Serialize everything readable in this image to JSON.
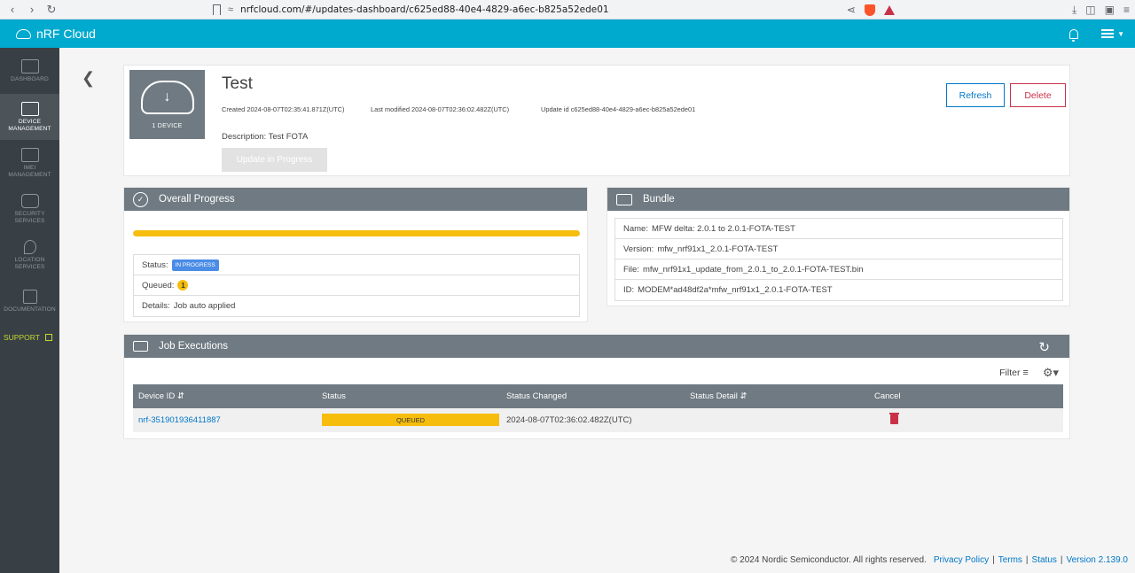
{
  "browser": {
    "url": "nrfcloud.com/#/updates-dashboard/c625ed88-40e4-4829-a6ec-b825a52ede01"
  },
  "header": {
    "app_name": "nRF Cloud"
  },
  "sidebar": {
    "items": [
      {
        "label": "DASHBOARD",
        "icon": "dashboard-icon"
      },
      {
        "label": "DEVICE MANAGEMENT",
        "icon": "device-management-icon"
      },
      {
        "label": "IMEI MANAGEMENT",
        "icon": "barcode-icon"
      },
      {
        "label": "SECURITY SERVICES",
        "icon": "lock-icon"
      },
      {
        "label": "LOCATION SERVICES",
        "icon": "location-pin-icon"
      },
      {
        "label": "DOCUMENTATION",
        "icon": "document-icon"
      }
    ],
    "support_label": "SUPPORT"
  },
  "update": {
    "thumb_label": "1 DEVICE",
    "title": "Test",
    "created": "Created 2024-08-07T02:35:41.871Z(UTC)",
    "modified": "Last modified 2024-08-07T02:36:02.482Z(UTC)",
    "update_id": "Update id c625ed88-40e4-4829-a6ec-b825a52ede01",
    "description_label": "Description:",
    "description_value": "Test FOTA",
    "progress_button": "Update in Progress",
    "refresh_button": "Refresh",
    "delete_button": "Delete"
  },
  "progress": {
    "title": "Overall Progress",
    "percent": 100,
    "status_label": "Status:",
    "status_value": "IN PROGRESS",
    "queued_label": "Queued:",
    "queued_value": "1",
    "details_label": "Details:",
    "details_value": "Job auto applied"
  },
  "bundle": {
    "title": "Bundle",
    "name_label": "Name:",
    "name_value": "MFW delta: 2.0.1 to 2.0.1-FOTA-TEST",
    "version_label": "Version:",
    "version_value": "mfw_nrf91x1_2.0.1-FOTA-TEST",
    "file_label": "File:",
    "file_value": "mfw_nrf91x1_update_from_2.0.1_to_2.0.1-FOTA-TEST.bin",
    "id_label": "ID:",
    "id_value": "MODEM*ad48df2a*mfw_nrf91x1_2.0.1-FOTA-TEST"
  },
  "jobs": {
    "title": "Job Executions",
    "filter_label": "Filter",
    "columns": [
      "Device ID",
      "Status",
      "Status Changed",
      "Status Detail",
      "Cancel"
    ],
    "rows": [
      {
        "device_id": "nrf-351901936411887",
        "status": "QUEUED",
        "status_changed": "2024-08-07T02:36:02.482Z(UTC)",
        "status_detail": ""
      }
    ]
  },
  "footer": {
    "copyright": "© 2024 Nordic Semiconductor. All rights reserved.",
    "privacy": "Privacy Policy",
    "terms": "Terms",
    "status": "Status",
    "version": "Version 2.139.0"
  },
  "colors": {
    "header": "#00a9ce",
    "sidebar": "#394045",
    "accent_blue": "#0077c8",
    "danger": "#c93149",
    "progress": "#f6bd0c",
    "panel_head": "#6f7a82"
  }
}
